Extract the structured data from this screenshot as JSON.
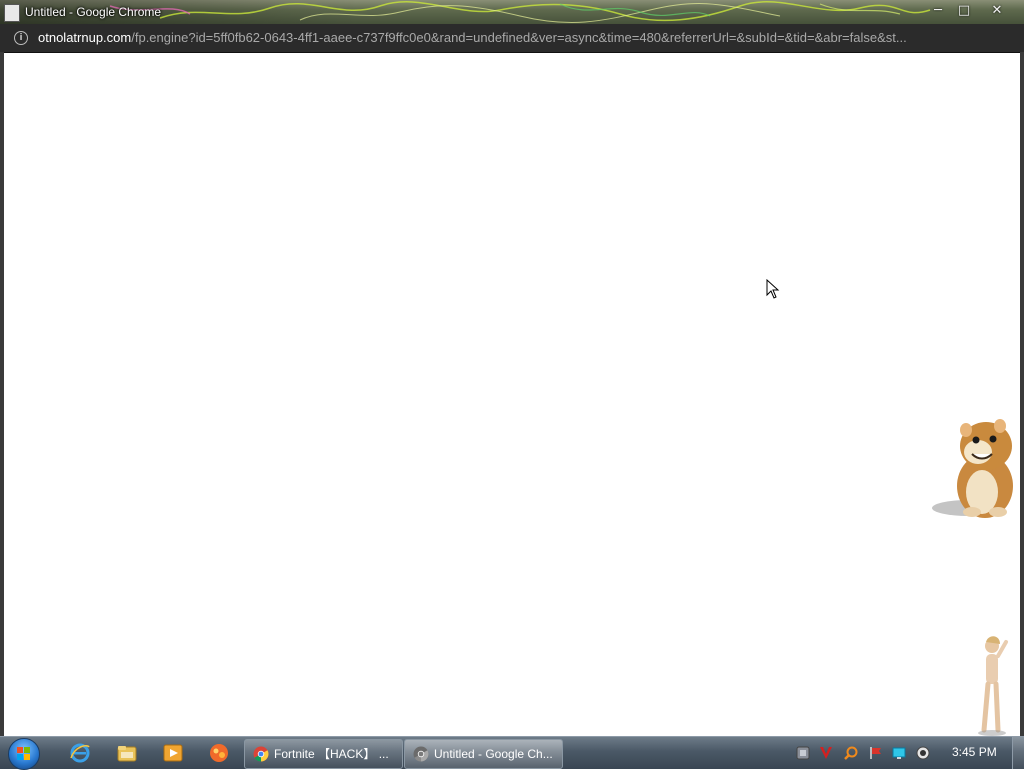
{
  "window": {
    "title": "Untitled - Google Chrome",
    "controls": {
      "minimize": "─",
      "maximize": "□",
      "close": "✕"
    }
  },
  "address_bar": {
    "host": "otnolatrnup.com",
    "path": "/fp.engine?id=5ff0fb62-0643-4ff1-aaee-c737f9ffc0e0&rand=undefined&ver=async&time=480&referrerUrl=&subId=&tid=&abr=false&st..."
  },
  "taskbar": {
    "pinned": [
      "internet-explorer-icon",
      "windows-explorer-icon",
      "media-player-icon",
      "app-icon"
    ],
    "tasks": [
      {
        "label": "Fortnite 【HACK】 ...",
        "icon": "chrome-icon",
        "active": false
      },
      {
        "label": "Untitled - Google Ch...",
        "icon": "chrome-icon",
        "active": true
      }
    ],
    "tray": [
      "tray-app-icon",
      "antivirus-icon",
      "search-icon",
      "flag-icon",
      "display-icon",
      "volume-icon"
    ],
    "clock": "3:45 PM"
  },
  "colors": {
    "addressbar_bg": "#2b2b2b",
    "taskbar_bg": "#4a5866",
    "page_bg": "#ffffff"
  }
}
